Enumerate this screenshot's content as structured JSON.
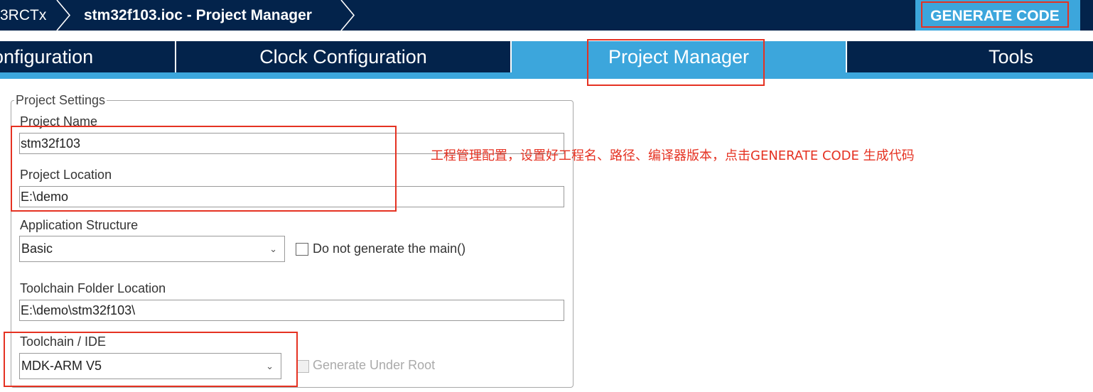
{
  "breadcrumb": {
    "device": "3RCTx",
    "project": "stm32f103.ioc - Project Manager"
  },
  "generate_button": "GENERATE CODE",
  "tabs": [
    {
      "label": "Configuration",
      "visible_label": "onfiguration"
    },
    {
      "label": "Clock Configuration"
    },
    {
      "label": "Project Manager",
      "active": true
    },
    {
      "label": "Tools"
    }
  ],
  "project_settings": {
    "legend": "Project Settings",
    "project_name_label": "Project Name",
    "project_name_value": "stm32f103",
    "project_location_label": "Project Location",
    "project_location_value": "E:\\demo",
    "app_structure_label": "Application Structure",
    "app_structure_value": "Basic",
    "no_main_label": "Do not generate the main()",
    "toolchain_folder_label": "Toolchain Folder Location",
    "toolchain_folder_value": "E:\\demo\\stm32f103\\",
    "toolchain_ide_label": "Toolchain / IDE",
    "toolchain_ide_value": "MDK-ARM V5",
    "generate_under_root_label": "Generate Under Root"
  },
  "annotation": "工程管理配置，设置好工程名、路径、编译器版本，点击GENERATE CODE 生成代码",
  "colors": {
    "navy": "#03234b",
    "accent": "#3ca6dc",
    "highlight_red": "#e53222"
  }
}
